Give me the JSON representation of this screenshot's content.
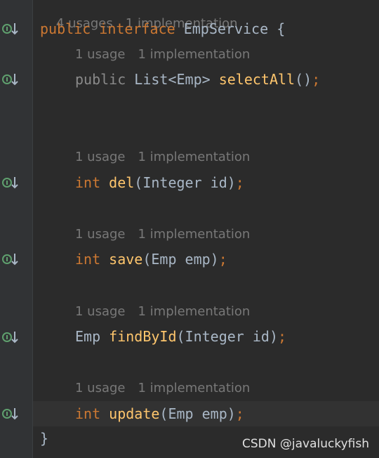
{
  "header_hint": {
    "usages": "4 usages",
    "implementations": "1 implementation"
  },
  "declaration": {
    "modifier": "public",
    "keyword": "interface",
    "name": "EmpService",
    "brace": "{"
  },
  "methods": [
    {
      "hint_usages": "1 usage",
      "hint_impl": "1 implementation",
      "modifier": "public",
      "return_type": "List<Emp>",
      "name": "selectAll",
      "params": "()",
      "semicolon": ";"
    },
    {
      "hint_usages": "1 usage",
      "hint_impl": "1 implementation",
      "return_type": "int",
      "name": "del",
      "params": "(Integer id)",
      "semicolon": ";"
    },
    {
      "hint_usages": "1 usage",
      "hint_impl": "1 implementation",
      "return_type": "int",
      "name": "save",
      "params": "(Emp emp)",
      "semicolon": ";"
    },
    {
      "hint_usages": "1 usage",
      "hint_impl": "1 implementation",
      "return_type": "Emp",
      "name": "findById",
      "params": "(Integer id)",
      "semicolon": ";"
    },
    {
      "hint_usages": "1 usage",
      "hint_impl": "1 implementation",
      "return_type": "int",
      "name": "update",
      "params": "(Emp emp)",
      "semicolon": ";"
    }
  ],
  "closing_brace": "}",
  "watermark": "CSDN @javaluckyfish",
  "gutter_icon": "implemented-down-arrow-icon",
  "colors": {
    "keyword": "#cc7832",
    "method": "#ffc66d",
    "text": "#a9b7c6",
    "hint": "#787878",
    "background": "#2b2b2b",
    "icon": "#5fa06e"
  }
}
